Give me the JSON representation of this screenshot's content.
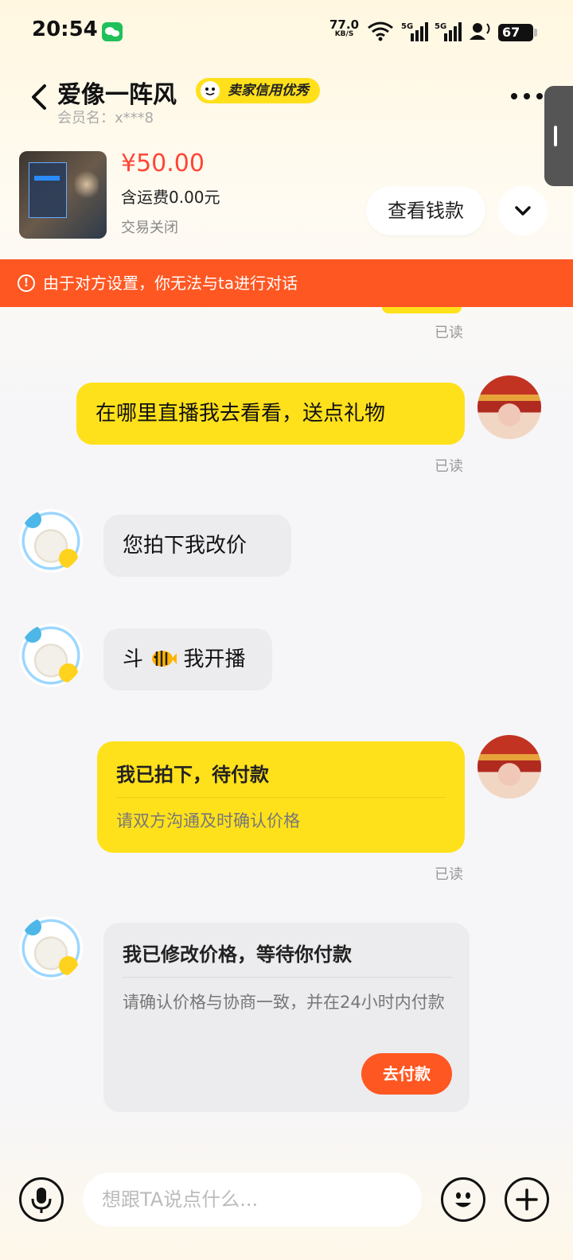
{
  "status_bar": {
    "time": "20:54",
    "net_speed": "77.0",
    "net_unit": "KB/S",
    "battery": "67"
  },
  "header": {
    "contact_name": "爱像一阵风",
    "seller_badge": "卖家信用优秀",
    "member_name": "会员名：x***8"
  },
  "product": {
    "price": "¥50.00",
    "shipping": "含运费0.00元",
    "trade_status": "交易关闭",
    "view_payment_label": "查看钱款"
  },
  "alert": {
    "text": "由于对方设置，你无法与ta进行对话"
  },
  "messages": {
    "read_label": "已读",
    "m1_text": "在哪里直播我去看看，送点礼物",
    "m2_text": "您拍下我改价",
    "m3_pre": "斗",
    "m3_post": "我开播",
    "m4_title": "我已拍下，待付款",
    "m4_sub": "请双方沟通及时确认价格",
    "m5_title": "我已修改价格，等待你付款",
    "m5_sub": "请确认价格与协商一致，并在24小时内付款",
    "m5_button": "去付款"
  },
  "input": {
    "placeholder": "想跟TA说点什么..."
  },
  "colors": {
    "accent_yellow": "#ffe11b",
    "alert_orange": "#ff5722",
    "price_red": "#ff4636"
  }
}
